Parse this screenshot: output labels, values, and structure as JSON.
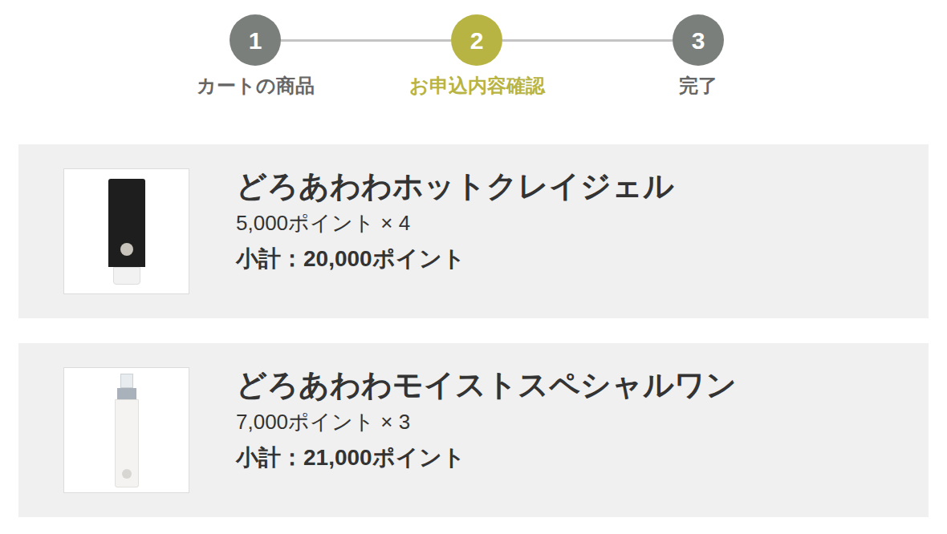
{
  "steps": [
    {
      "number": "1",
      "label": "カートの商品",
      "selected": false
    },
    {
      "number": "2",
      "label": "お申込内容確認",
      "selected": true
    },
    {
      "number": "3",
      "label": "完了",
      "selected": false
    }
  ],
  "items": [
    {
      "name": "どろあわわホットクレイジェル",
      "price": "5,000ポイント × 4",
      "subtotal": "小計：20,000ポイント",
      "kind": "tube"
    },
    {
      "name": "どろあわわモイストスペシャルワン",
      "price": "7,000ポイント × 3",
      "subtotal": "小計：21,000ポイント",
      "kind": "bottle"
    }
  ]
}
